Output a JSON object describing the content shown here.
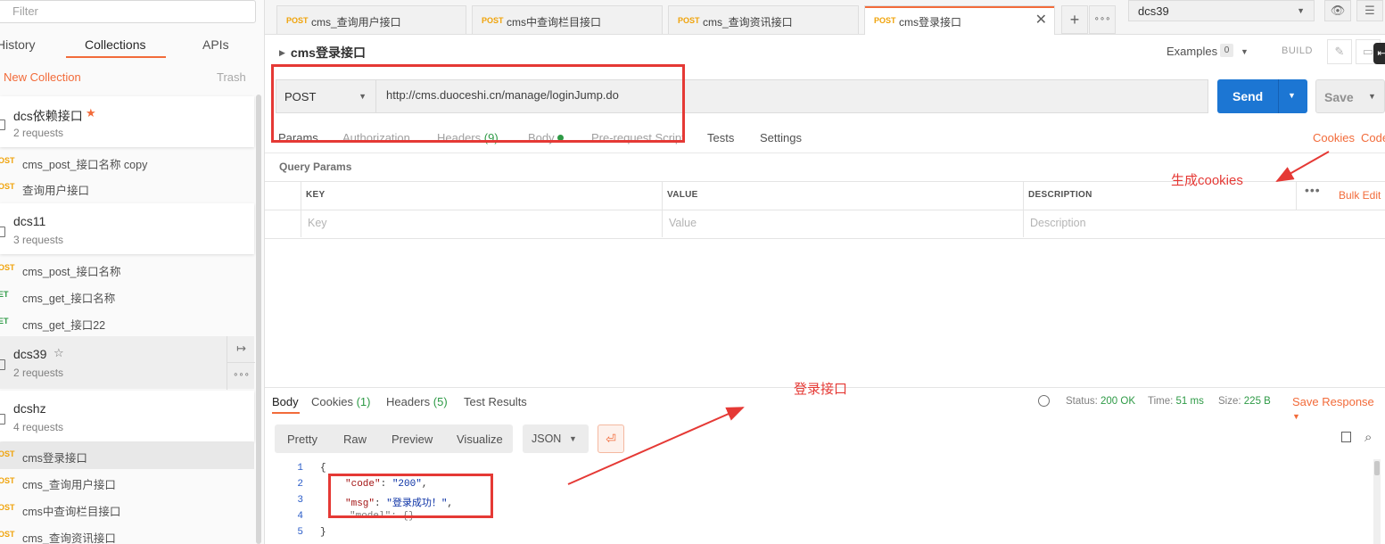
{
  "colors": {
    "accent": "#f26b3a",
    "send_blue": "#1c76d3",
    "post": "#f0a30a",
    "get": "#2e9a46",
    "annotation_red": "#e53935"
  },
  "sidebar": {
    "filter_placeholder": "Filter",
    "tabs": [
      "History",
      "Collections",
      "APIs"
    ],
    "active_tab": "Collections",
    "new_collection": "New Collection",
    "trash": "Trash",
    "collections": [
      {
        "name": "dcs依赖接口",
        "requests": "2 requests",
        "starred": true
      },
      {
        "name": "dcs11",
        "requests": "3 requests",
        "starred": false
      },
      {
        "name": "dcs39",
        "requests": "2 requests",
        "starred": false
      },
      {
        "name": "dcshz",
        "requests": "4 requests",
        "starred": false
      }
    ],
    "requests_dcs_dep": [
      {
        "method": "OST",
        "name": "cms_post_接口名称 copy"
      },
      {
        "method": "OST",
        "name": "查询用户接口"
      }
    ],
    "requests_dcs11": [
      {
        "method": "OST",
        "name": "cms_post_接口名称"
      },
      {
        "method": "ET",
        "name": "cms_get_接口名称"
      },
      {
        "method": "ET",
        "name": "cms_get_接口22"
      }
    ],
    "requests_dcshz": [
      {
        "method": "OST",
        "name": "cms登录接口"
      },
      {
        "method": "OST",
        "name": "cms_查询用户接口"
      },
      {
        "method": "OST",
        "name": "cms中查询栏目接口"
      },
      {
        "method": "OST",
        "name": "cms_查询资讯接口"
      }
    ],
    "share_icon": "↦",
    "more_icon": "∘∘∘"
  },
  "tabs": [
    {
      "method": "POST",
      "name": "cms_查询用户接口"
    },
    {
      "method": "POST",
      "name": "cms中查询栏目接口"
    },
    {
      "method": "POST",
      "name": "cms_查询资讯接口"
    },
    {
      "method": "POST",
      "name": "cms登录接口"
    }
  ],
  "tabbar": {
    "close": "✕",
    "add": "+",
    "more": "∘∘∘"
  },
  "environment": {
    "selected": "dcs39"
  },
  "request": {
    "title": "cms登录接口",
    "examples_label": "Examples",
    "examples_count": "0",
    "build_label": "BUILD",
    "method": "POST",
    "url": "http://cms.duoceshi.cn/manage/loginJump.do",
    "send_label": "Send",
    "save_label": "Save",
    "param_tabs": {
      "params": "Params",
      "authorization": "Authorization",
      "headers": "Headers",
      "headers_count": "(9)",
      "body": "Body",
      "prerequest": "Pre-request Script",
      "tests": "Tests",
      "settings": "Settings"
    },
    "cookies_link": "Cookies",
    "code_link": "Code",
    "query_params_title": "Query Params",
    "columns": {
      "key": "KEY",
      "value": "VALUE",
      "description": "DESCRIPTION"
    },
    "placeholders": {
      "key": "Key",
      "value": "Value",
      "description": "Description"
    },
    "bulk_edit": "Bulk Edit",
    "more": "•••"
  },
  "response": {
    "tabs": {
      "body": "Body",
      "cookies": "Cookies",
      "cookies_count": "(1)",
      "headers": "Headers",
      "headers_count": "(5)",
      "tests": "Test Results"
    },
    "status_label": "Status:",
    "status": "200 OK",
    "time_label": "Time:",
    "time": "51 ms",
    "size_label": "Size:",
    "size": "225 B",
    "save_response": "Save Response",
    "view_tabs": [
      "Pretty",
      "Raw",
      "Preview",
      "Visualize"
    ],
    "format": "JSON",
    "line_numbers": [
      "1",
      "2",
      "3",
      "4",
      "5"
    ],
    "lines": {
      "l1": "{",
      "l2_key": "\"code\"",
      "l2_sep": ": ",
      "l2_val": "\"200\"",
      "l2_end": ",",
      "l3_key": "\"msg\"",
      "l3_sep": ": ",
      "l3_val": "\"登录成功！\"",
      "l3_end": ",",
      "l4": "\"model\": {}",
      "l5": "}"
    }
  },
  "annotations": {
    "cookies_note": "生成cookies",
    "login_note": "登录接口"
  }
}
